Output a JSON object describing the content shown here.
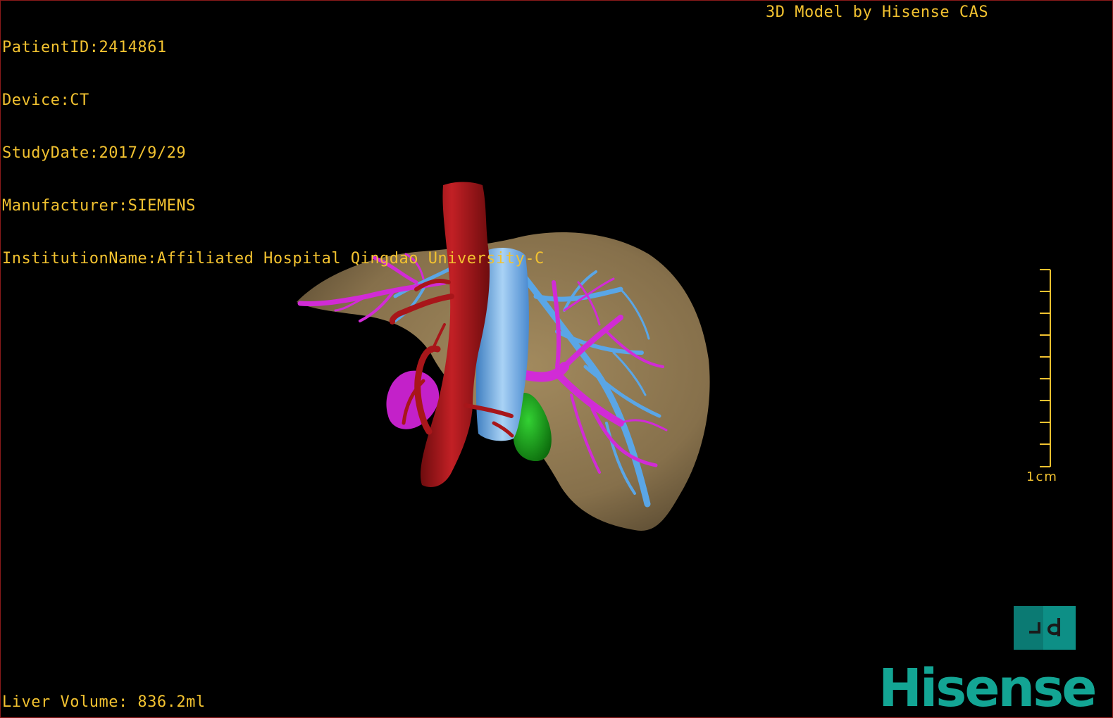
{
  "info": {
    "patient_id": "PatientID:2414861",
    "device": "Device:CT",
    "study_date": "StudyDate:2017/9/29",
    "manufacturer": "Manufacturer:SIEMENS",
    "institution": "InstitutionName:Affiliated Hospital Qingdao University-C"
  },
  "credit": "3D Model by Hisense CAS",
  "liver_volume": "Liver Volume: 836.2ml",
  "scale_label": "1cm",
  "orientation_cube_glyph": "┐d",
  "brand": "Hisense",
  "colors": {
    "overlay_text": "#f2c230",
    "liver": "#8b7650",
    "artery": "#a8161a",
    "portal_vein": "#d12bd6",
    "hepatic_vein": "#5aa6e6",
    "gallbladder": "#1aa61a",
    "brand": "#13a594"
  }
}
